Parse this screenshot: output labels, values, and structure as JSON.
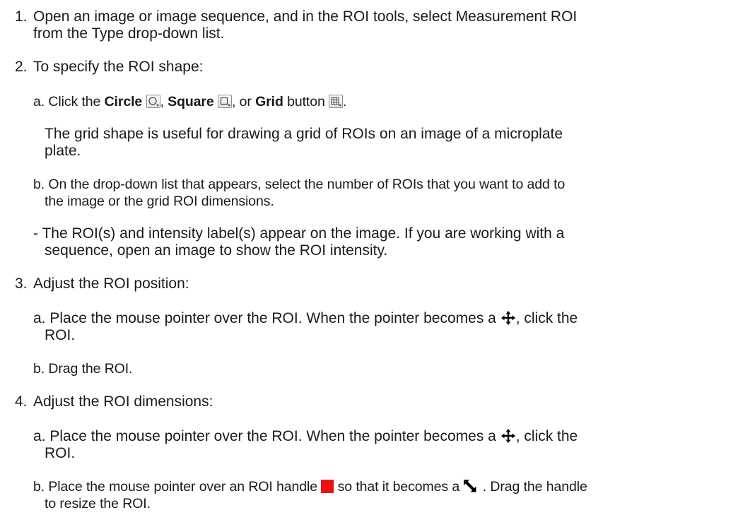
{
  "steps": {
    "s1": {
      "number": "1.",
      "line1": "Open an image or image sequence, and in the ROI tools, select Measurement ROI",
      "line2": "from the Type drop-down list."
    },
    "s2": {
      "number": "2.",
      "line1": "To specify the ROI shape:",
      "a": {
        "prefix": "a. Click the ",
        "circle": "Circle",
        "sep1": ", ",
        "square": "Square",
        "sep2": ", or ",
        "grid": "Grid",
        "suffix_before_icon": " button ",
        "end": "."
      },
      "note_line1": "The grid shape is useful for drawing a grid of ROIs on an image of a microplate",
      "note_line2": "plate.",
      "b_line1": "b. On the drop-down list that appears, select the number of ROIs that you want to add to",
      "b_line2": "the image or the grid ROI dimensions.",
      "r_line1": "- The ROI(s) and intensity label(s) appear on the image. If you are working with a",
      "r_line2": "sequence, open an image to show the ROI intensity."
    },
    "s3": {
      "number": "3.",
      "line1": "Adjust the ROI position:",
      "a_line1_pre": "a. Place the mouse pointer over the ROI. When the pointer becomes a ",
      "a_line1_post": ", click the",
      "a_line2": "ROI.",
      "b_line1": "b. Drag the ROI."
    },
    "s4": {
      "number": "4.",
      "line1": "Adjust the ROI dimensions:",
      "a_line1_pre": "a. Place the mouse pointer over the ROI. When the pointer becomes a ",
      "a_line1_post": ", click the",
      "a_line2": "ROI.",
      "b_line1_pre": "b. Place the mouse pointer over an ROI handle ",
      "b_line1_mid": " so that it becomes a ",
      "b_line1_post": " . Drag the handle",
      "b_line2": "to resize the ROI."
    }
  },
  "icons": {
    "circle": "circle-roi-icon",
    "square": "square-roi-icon",
    "grid": "grid-roi-icon",
    "move": "move-cursor-icon",
    "handle": "roi-handle-icon",
    "resize": "resize-cursor-icon"
  },
  "colors": {
    "handle": "#ee1111",
    "text": "#1a1a1a"
  }
}
